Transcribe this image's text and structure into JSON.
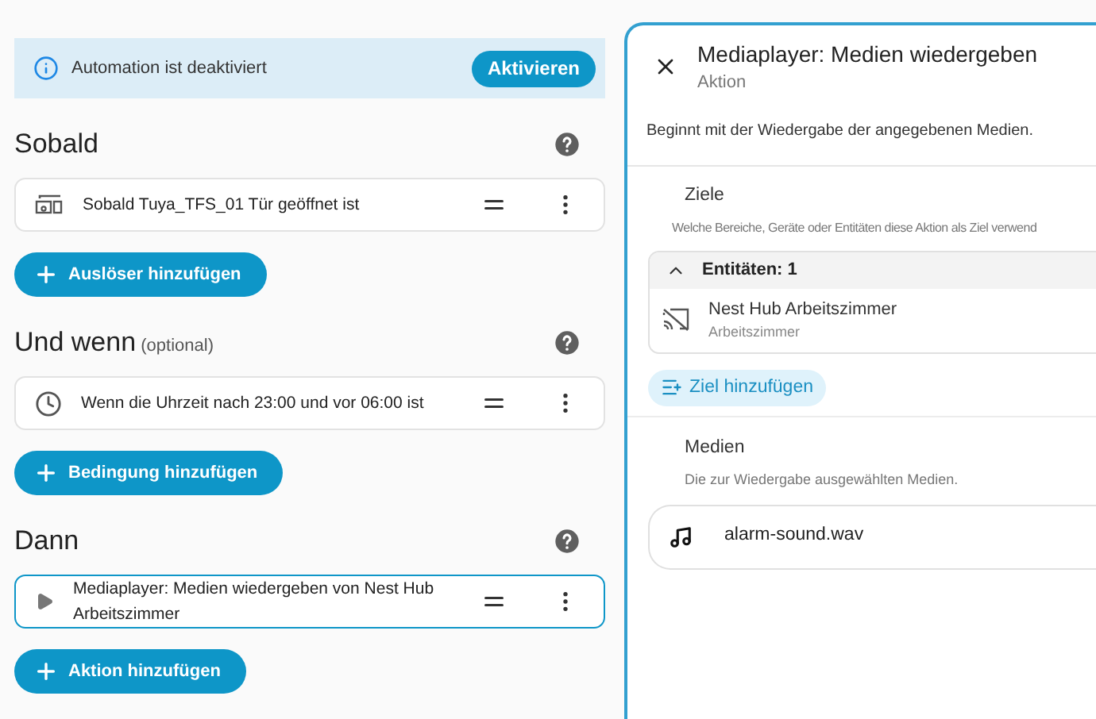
{
  "banner": {
    "text": "Automation ist deaktiviert",
    "button": "Aktivieren"
  },
  "sections": [
    {
      "heading": "Sobald",
      "items": [
        {
          "kind": "device",
          "text": "Sobald Tuya_TFS_01 Tür geöffnet ist",
          "selected": false
        }
      ],
      "add_button": "Auslöser hinzufügen"
    },
    {
      "heading": "Und wenn",
      "note": "(optional)",
      "items": [
        {
          "kind": "time",
          "text": "Wenn die Uhrzeit nach 23:00 und vor 06:00 ist",
          "selected": false
        }
      ],
      "add_button": "Bedingung hinzufügen"
    },
    {
      "heading": "Dann",
      "items": [
        {
          "kind": "action",
          "text": "Mediaplayer: Medien wiedergeben von Nest Hub Arbeitszimmer",
          "selected": true
        }
      ],
      "add_button": "Aktion hinzufügen"
    }
  ],
  "panel": {
    "title": "Mediaplayer: Medien wiedergeben",
    "subtitle": "Aktion",
    "description": "Beginnt mit der Wiedergabe der angegebenen Medien.",
    "targets": {
      "label": "Ziele",
      "hint": "Welche Bereiche, Geräte oder Entitäten diese Aktion als Ziel verwend",
      "group": {
        "label": "Entitäten: 1",
        "expanded": true,
        "entities": [
          {
            "name": "Nest Hub Arbeitszimmer",
            "area": "Arbeitszimmer"
          }
        ]
      },
      "add_button": "Ziel hinzufügen"
    },
    "media": {
      "label": "Medien",
      "hint": "Die zur Wiedergabe ausgewählten Medien.",
      "value": "alarm-sound.wav"
    }
  }
}
